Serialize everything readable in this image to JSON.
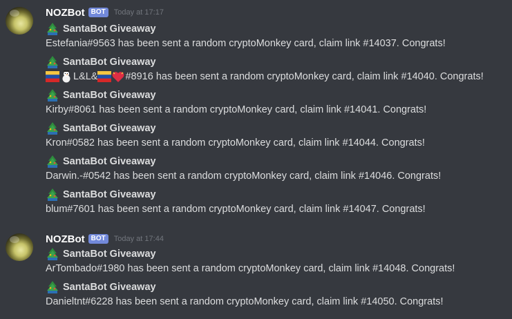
{
  "groups": [
    {
      "username": "NOZBot",
      "bot_tag": "BOT",
      "timestamp": "Today at 17:17",
      "messages": [
        {
          "title": "SantaBot Giveaway",
          "text": "Estefania#9563 has been sent a random cryptoMonkey card, claim link #14037. Congrats!"
        },
        {
          "title": "SantaBot Giveaway",
          "text_prefix": "L&L&",
          "text": "#8916 has been sent a random cryptoMonkey card, claim link #14040. Congrats!"
        },
        {
          "title": "SantaBot Giveaway",
          "text": "Kirby#8061 has been sent a random cryptoMonkey card, claim link #14041. Congrats!"
        },
        {
          "title": "SantaBot Giveaway",
          "text": "Kron#0582 has been sent a random cryptoMonkey card, claim link #14044. Congrats!"
        },
        {
          "title": "SantaBot Giveaway",
          "text": "Darwin.-#0542 has been sent a random cryptoMonkey card, claim link #14046. Congrats!"
        },
        {
          "title": "SantaBot Giveaway",
          "text": "blum#7601 has been sent a random cryptoMonkey card, claim link #14047. Congrats!"
        }
      ]
    },
    {
      "username": "NOZBot",
      "bot_tag": "BOT",
      "timestamp": "Today at 17:44",
      "messages": [
        {
          "title": "SantaBot Giveaway",
          "text": "ArTombado#1980 has been sent a random cryptoMonkey card, claim link #14048. Congrats!"
        },
        {
          "title": "SantaBot Giveaway",
          "text": "Danieltnt#6228 has been sent a random cryptoMonkey card, claim link #14050. Congrats!"
        }
      ]
    }
  ],
  "icons": {
    "title_icon": "christmas-tree-icon",
    "flag_icon": "venezuela-flag-icon",
    "snowman_icon": "snowman-icon",
    "heart_icon": "red-heart-icon"
  },
  "colors": {
    "background": "#36393f",
    "username": "#ffffff",
    "text": "#dcddde",
    "timestamp": "#72767d",
    "bot_tag": "#7289da"
  }
}
